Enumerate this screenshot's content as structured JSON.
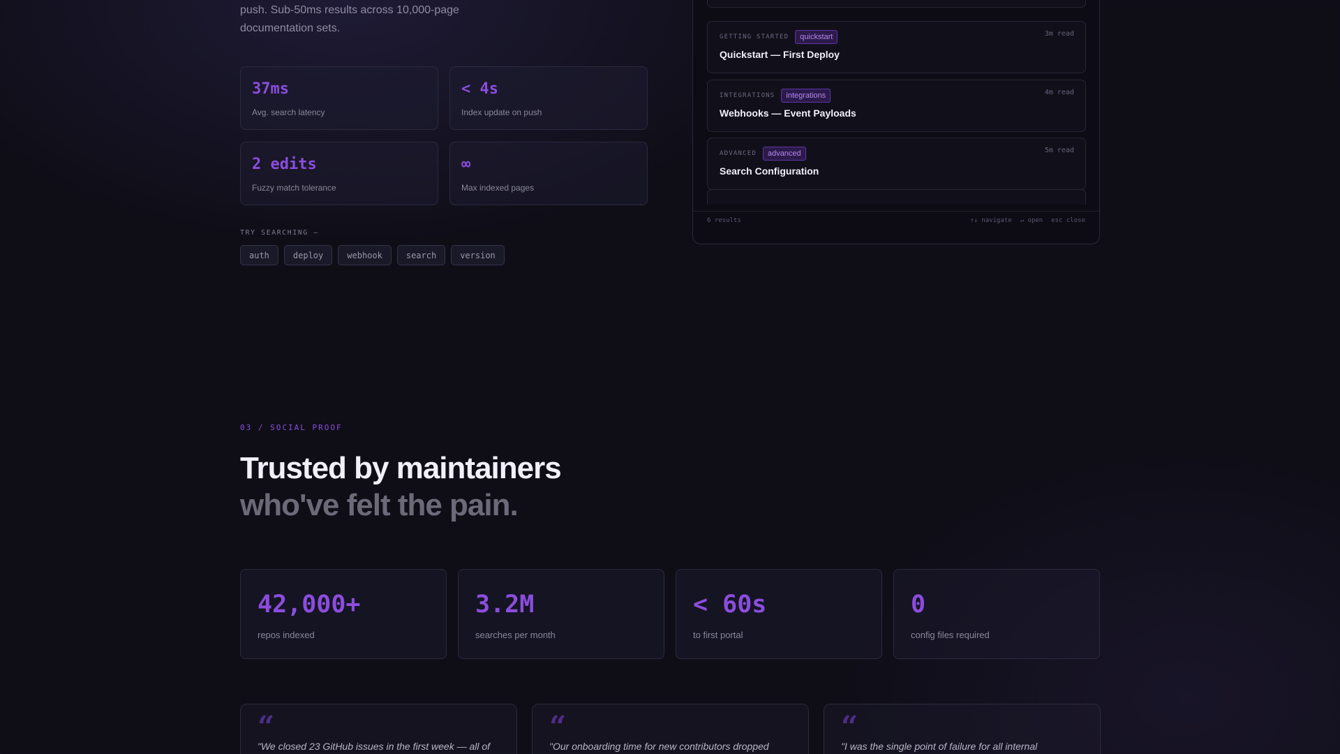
{
  "hero": {
    "description": "push. Sub-50ms results across 10,000-page documentation sets.",
    "stats": [
      {
        "value": "37ms",
        "label": "Avg. search latency"
      },
      {
        "value": "< 4s",
        "label": "Index update on push"
      },
      {
        "value": "2 edits",
        "label": "Fuzzy match tolerance"
      },
      {
        "value": "∞",
        "label": "Max indexed pages"
      }
    ],
    "try_label": "TRY SEARCHING —",
    "try_chips": [
      "auth",
      "deploy",
      "webhook",
      "search",
      "version"
    ]
  },
  "search_panel": {
    "results": [
      {
        "category": "GETTING STARTED",
        "tag": "quickstart",
        "read": "3m read",
        "title": "Quickstart — First Deploy"
      },
      {
        "category": "INTEGRATIONS",
        "tag": "integrations",
        "read": "4m read",
        "title": "Webhooks — Event Payloads"
      },
      {
        "category": "ADVANCED",
        "tag": "advanced",
        "read": "5m read",
        "title": "Search Configuration"
      }
    ],
    "footer": {
      "count": "6 results",
      "hint_navigate": "↑↓ navigate",
      "hint_open": "↵ open",
      "hint_close": "esc close"
    }
  },
  "social_proof": {
    "eyebrow": "03 / SOCIAL PROOF",
    "heading_line1": "Trusted by maintainers",
    "heading_line2": "who've felt the pain.",
    "metrics": [
      {
        "value": "42,000+",
        "label": "repos indexed"
      },
      {
        "value": "3.2M",
        "label": "searches per month"
      },
      {
        "value": "< 60s",
        "label": "to first portal"
      },
      {
        "value": "0",
        "label": "config files required"
      }
    ],
    "quote_mark": "“",
    "quotes": [
      "\"We closed 23 GitHub issues in the first week — all of",
      "\"Our onboarding time for new contributors dropped",
      "\"I was the single point of failure for all internal"
    ]
  },
  "colors": {
    "accent": "#8b4dde",
    "background": "#0f0e17",
    "tag_bg": "#2b1a4a"
  }
}
